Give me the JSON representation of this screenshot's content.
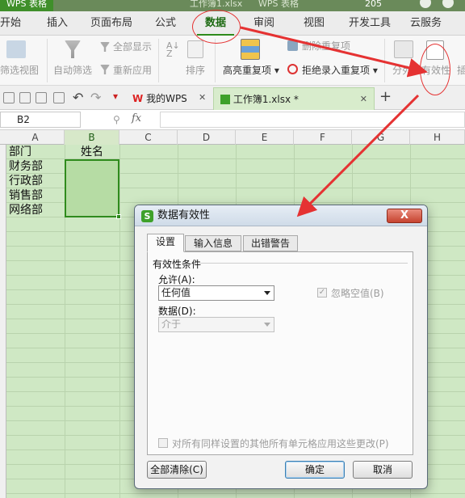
{
  "titlebar": {
    "brand": "WPS 表格",
    "doc": "工作簿1.xlsx",
    "app": "WPS 表格",
    "user": "205"
  },
  "menu": [
    "开始",
    "插入",
    "页面布局",
    "公式",
    "数据",
    "审阅",
    "视图",
    "开发工具",
    "云服务"
  ],
  "menu_active": "数据",
  "ribbon": {
    "filter_view": "筛选视图",
    "auto_filter": "自动筛选",
    "show_all": "全部显示",
    "reapply": "重新应用",
    "sort": "排序",
    "highlight_dup": "高亮重复项",
    "delete_dup": "删除重复项",
    "reject_dup": "拒绝录入重复项",
    "split": "分列",
    "validity": "有效性",
    "more": "插"
  },
  "tabs": {
    "mywps": "我的WPS",
    "workbook": "工作簿1.xlsx *"
  },
  "namebox": "B2",
  "fx": "fx",
  "columns": [
    "A",
    "B",
    "C",
    "D",
    "E",
    "F",
    "G",
    "H"
  ],
  "cells": {
    "a1": "部门",
    "b1": "姓名",
    "a2": "财务部",
    "a3": "行政部",
    "a4": "销售部",
    "a5": "网络部"
  },
  "dialog": {
    "title": "数据有效性",
    "close": "X",
    "tabs": [
      "设置",
      "输入信息",
      "出错警告"
    ],
    "group": "有效性条件",
    "allow_label": "允许(A):",
    "allow_value": "任何值",
    "ignore_blank": "忽略空值(B)",
    "data_label": "数据(D):",
    "data_value": "介于",
    "apply_all": "对所有同样设置的其他所有单元格应用这些更改(P)",
    "clear_all": "全部清除(C)",
    "ok": "确定",
    "cancel": "取消"
  },
  "annotation_color": "#e53232",
  "accent": "#2e8b1c"
}
